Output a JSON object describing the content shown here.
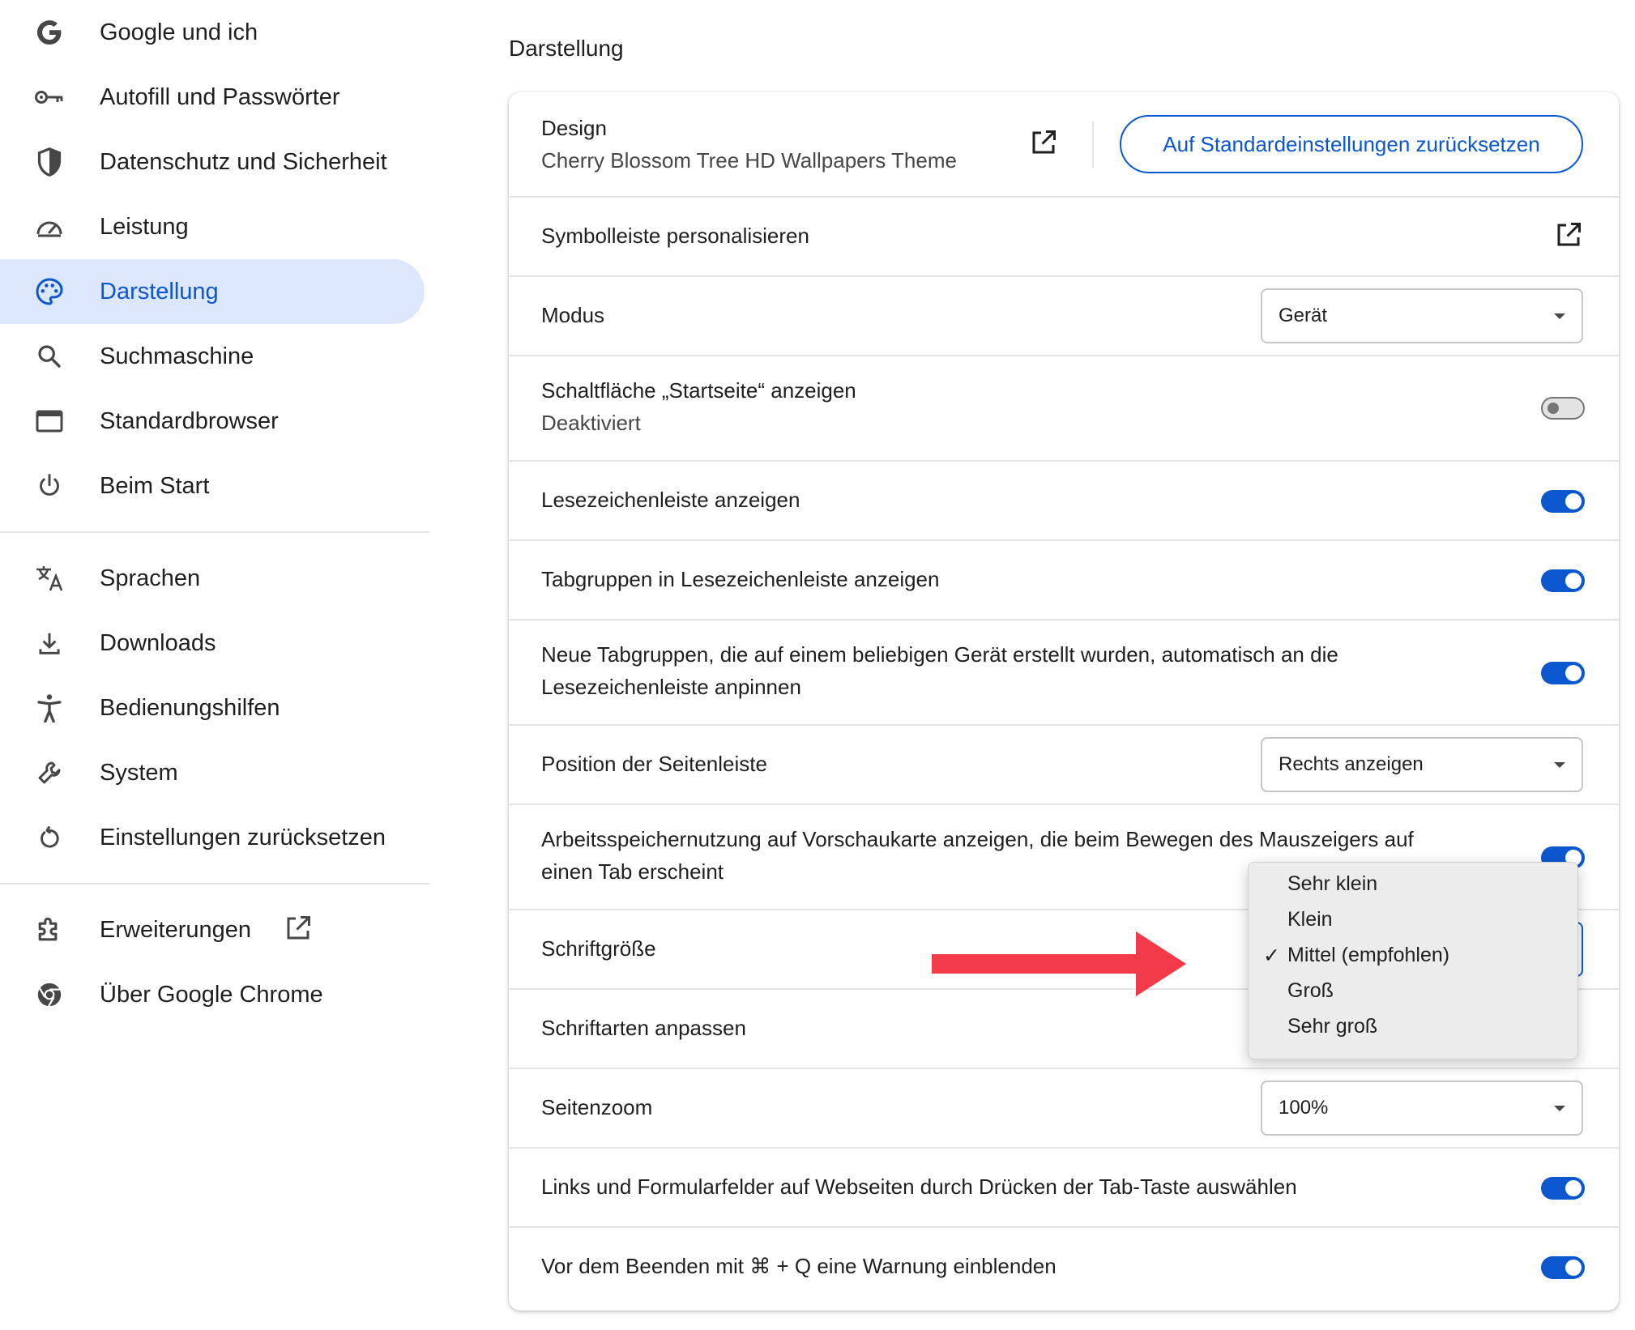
{
  "sidebar": {
    "items": [
      {
        "label": "Google und ich",
        "icon": "google-g-icon"
      },
      {
        "label": "Autofill und Passwörter",
        "icon": "key-icon"
      },
      {
        "label": "Datenschutz und Sicherheit",
        "icon": "shield-icon"
      },
      {
        "label": "Leistung",
        "icon": "speedometer-icon"
      },
      {
        "label": "Darstellung",
        "icon": "palette-icon",
        "active": true
      },
      {
        "label": "Suchmaschine",
        "icon": "search-icon"
      },
      {
        "label": "Standardbrowser",
        "icon": "browser-window-icon"
      },
      {
        "label": "Beim Start",
        "icon": "power-icon"
      },
      {
        "label": "Sprachen",
        "icon": "translate-icon"
      },
      {
        "label": "Downloads",
        "icon": "download-icon"
      },
      {
        "label": "Bedienungshilfen",
        "icon": "accessibility-icon"
      },
      {
        "label": "System",
        "icon": "wrench-icon"
      },
      {
        "label": "Einstellungen zurücksetzen",
        "icon": "reset-icon"
      },
      {
        "label": "Erweiterungen",
        "icon": "puzzle-icon"
      },
      {
        "label": "Über Google Chrome",
        "icon": "chrome-icon"
      }
    ]
  },
  "main": {
    "section_title": "Darstellung",
    "design": {
      "label": "Design",
      "value": "Cherry Blossom Tree HD Wallpapers Theme",
      "reset_button": "Auf Standardeinstellungen zurücksetzen"
    },
    "toolbar": {
      "label": "Symbolleiste personalisieren"
    },
    "mode": {
      "label": "Modus",
      "value": "Gerät"
    },
    "home_button": {
      "label": "Schaltfläche „Startseite“ anzeigen",
      "sub": "Deaktiviert",
      "enabled": false
    },
    "bookmarks_bar": {
      "label": "Lesezeichenleiste anzeigen",
      "enabled": true
    },
    "tab_groups": {
      "label": "Tabgruppen in Lesezeichenleiste anzeigen",
      "enabled": true
    },
    "auto_pin": {
      "label_line1": "Neue Tabgruppen, die auf einem beliebigen Gerät erstellt wurden, automatisch an die",
      "label_line2": "Lesezeichenleiste anpinnen",
      "enabled": true
    },
    "sidebar_position": {
      "label": "Position der Seitenleiste",
      "value": "Rechts anzeigen"
    },
    "memory_usage": {
      "label_line1": "Arbeitsspeichernutzung auf Vorschaukarte anzeigen, die beim Bewegen des Mauszeigers auf",
      "label_line2": "einen Tab erscheint",
      "enabled": true
    },
    "font_size": {
      "label": "Schriftgröße"
    },
    "customize_fonts": {
      "label": "Schriftarten anpassen"
    },
    "page_zoom": {
      "label": "Seitenzoom",
      "value": "100%"
    },
    "tab_select": {
      "label": "Links und Formularfelder auf Webseiten durch Drücken der Tab-Taste auswählen",
      "enabled": true
    },
    "quit_warning": {
      "label": "Vor dem Beenden mit ⌘ + Q eine Warnung einblenden",
      "enabled": true
    }
  },
  "font_size_menu": {
    "options": [
      "Sehr klein",
      "Klein",
      "Mittel (empfohlen)",
      "Groß",
      "Sehr groß"
    ],
    "selected_index": 2,
    "check_mark": "✓"
  },
  "colors": {
    "accent": "#0b57d0",
    "active_nav_bg": "#dde7fb",
    "arrow": "#f33a48"
  }
}
